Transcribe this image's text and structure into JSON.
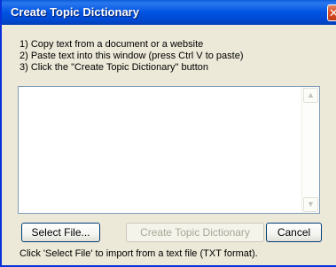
{
  "window": {
    "title": "Create Topic Dictionary",
    "close_glyph": "✕"
  },
  "instructions": [
    "1) Copy text from a document or a website",
    "2) Paste text into this window (press Ctrl V to paste)",
    "3) Click the \"Create Topic Dictionary\" button"
  ],
  "text_input": {
    "value": "",
    "placeholder": ""
  },
  "scrollbar": {
    "up_arrow": "▲",
    "down_arrow": "▼"
  },
  "buttons": {
    "select_file": "Select File...",
    "create_dictionary": "Create Topic Dictionary",
    "cancel": "Cancel"
  },
  "status": "Click 'Select File' to import from a text file (TXT format).",
  "colors": {
    "titlebar": "#0053e1",
    "window_bg": "#ece9d8",
    "close_button": "#d8532c",
    "disabled_text": "#a9a798"
  }
}
